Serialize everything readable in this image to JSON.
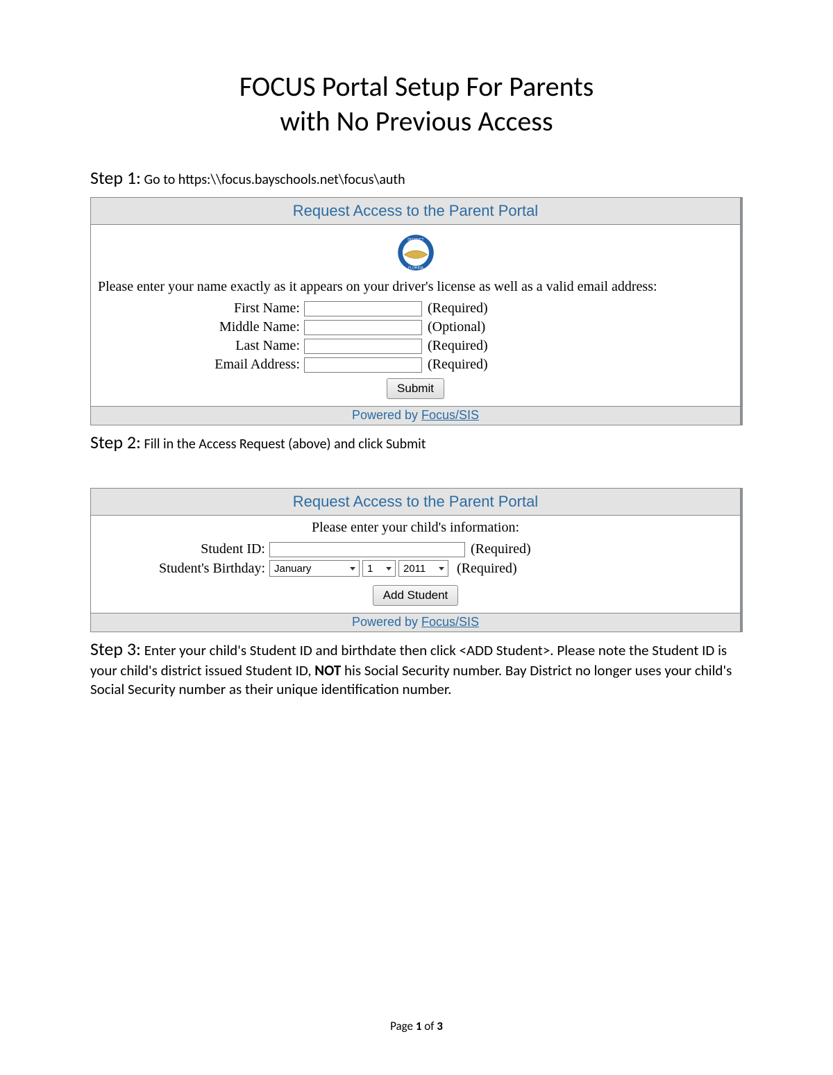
{
  "doc": {
    "title_line1": "FOCUS Portal Setup For Parents",
    "title_line2": "with No Previous Access"
  },
  "step1": {
    "label": "Step 1:",
    "text": "Go to https:\\\\focus.bayschools.net\\focus\\auth"
  },
  "panel1": {
    "header": "Request Access to the Parent Portal",
    "instruction": "Please enter your name exactly as it appears on your driver's license as well as a valid email address:",
    "fields": {
      "first": {
        "label": "First Name:",
        "hint": "(Required)"
      },
      "middle": {
        "label": "Middle Name:",
        "hint": "(Optional)"
      },
      "last": {
        "label": "Last Name:",
        "hint": "(Required)"
      },
      "email": {
        "label": "Email Address:",
        "hint": "(Required)"
      }
    },
    "submit": "Submit",
    "footer_prefix": "Powered by ",
    "footer_link": "Focus/SIS"
  },
  "step2": {
    "label": "Step 2:",
    "text": "Fill in the Access Request (above) and click Submit"
  },
  "panel2": {
    "header": "Request Access to the Parent Portal",
    "instruction": "Please enter your child's information:",
    "student_id": {
      "label": "Student ID:",
      "hint": "(Required)"
    },
    "birthday": {
      "label": "Student's Birthday:",
      "month": "January",
      "day": "1",
      "year": "2011",
      "hint": "(Required)"
    },
    "add_btn": "Add Student",
    "footer_prefix": "Powered by ",
    "footer_link": "Focus/SIS"
  },
  "step3": {
    "label": "Step 3:",
    "text_a": "Enter your child's Student ID and birthdate then click <ADD Student>. Please note the Student ID is your child's district issued Student ID, ",
    "not": "NOT",
    "text_b": " his Social Security number. Bay District no longer uses your child's Social Security number as their unique identification number."
  },
  "pagenum": {
    "prefix": "Page ",
    "cur": "1",
    "mid": " of ",
    "total": "3"
  }
}
